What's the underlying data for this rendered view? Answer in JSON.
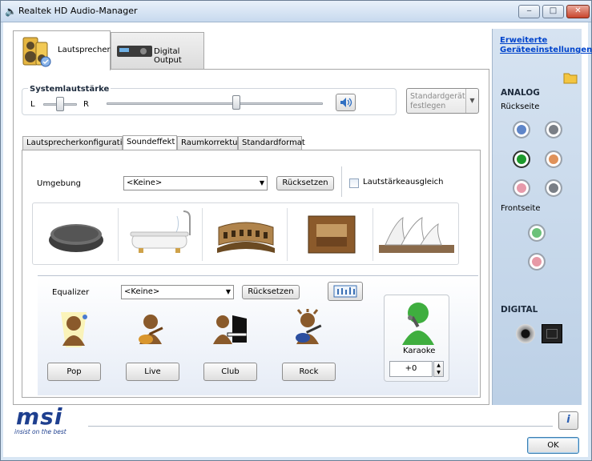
{
  "window": {
    "title": "Realtek HD Audio-Manager"
  },
  "device_tabs": [
    {
      "label": "Lautsprecher"
    },
    {
      "label": "Digital Output"
    }
  ],
  "volume": {
    "label": "Systemlautstärke",
    "left": "L",
    "right": "R",
    "balance": 0.5,
    "level": 0.6
  },
  "standard_device": {
    "label": "Standardgerät festlegen"
  },
  "sub_tabs": [
    {
      "label": "Lautsprecherkonfiguration"
    },
    {
      "label": "Soundeffekt"
    },
    {
      "label": "Raumkorrektur"
    },
    {
      "label": "Standardformat"
    }
  ],
  "environment": {
    "label": "Umgebung",
    "value": "<Keine>",
    "reset": "Rücksetzen",
    "loudness": "Lautstärkeausgleich",
    "loudness_checked": false
  },
  "equalizer": {
    "label": "Equalizer",
    "value": "<Keine>",
    "reset": "Rücksetzen"
  },
  "presets": [
    {
      "label": "Pop"
    },
    {
      "label": "Live"
    },
    {
      "label": "Club"
    },
    {
      "label": "Rock"
    }
  ],
  "karaoke": {
    "label": "Karaoke",
    "value": "+0"
  },
  "sidebar": {
    "advanced_link": "Erweiterte Geräteeinstellungen",
    "analog": "ANALOG",
    "back": "Rückseite",
    "front": "Frontseite",
    "digital": "DIGITAL",
    "jack_colors": {
      "blue": "#5f86c9",
      "gray": "#7a7f86",
      "green": "#1d9a2c",
      "orange": "#e0925a",
      "pink": "#e79aab",
      "front_green": "#6cc27a",
      "front_pink": "#e799a6"
    }
  },
  "brand": {
    "logo": "msi",
    "tagline": "insist on the best"
  },
  "ok_button": "OK"
}
